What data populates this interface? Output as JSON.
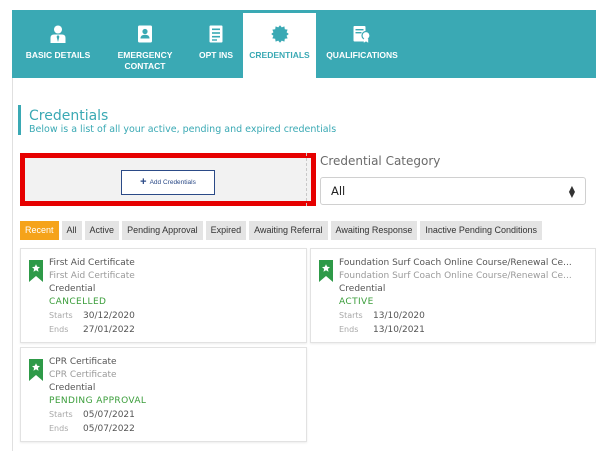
{
  "tabs": [
    {
      "label": "BASIC DETAILS",
      "icon": "person-icon"
    },
    {
      "label": "EMERGENCY CONTACT",
      "icon": "id-card-icon"
    },
    {
      "label": "OPT INS",
      "icon": "checklist-icon"
    },
    {
      "label": "CREDENTIALS",
      "icon": "badge-seal-icon",
      "active": true
    },
    {
      "label": "QUALIFICATIONS",
      "icon": "certificate-icon"
    }
  ],
  "section": {
    "title": "Credentials",
    "subtitle": "Below is a list of all your active, pending and expired credentials"
  },
  "add_button": {
    "label": "Add Credentials",
    "icon": "plus-icon"
  },
  "category": {
    "label": "Credential Category",
    "selected": "All"
  },
  "filters": [
    {
      "label": "Recent",
      "active": true
    },
    {
      "label": "All"
    },
    {
      "label": "Active"
    },
    {
      "label": "Pending Approval"
    },
    {
      "label": "Expired"
    },
    {
      "label": "Awaiting Referral"
    },
    {
      "label": "Awaiting Response"
    },
    {
      "label": "Inactive Pending Conditions"
    }
  ],
  "dates": {
    "starts_label": "Starts",
    "ends_label": "Ends"
  },
  "cards": [
    {
      "title": "First Aid Certificate",
      "subtitle": "First Aid Certificate",
      "type": "Credential",
      "status": "CANCELLED",
      "starts": "30/12/2020",
      "ends": "27/01/2022",
      "status_color": "#3a9d3a"
    },
    {
      "title": "Foundation Surf Coach Online Course/Renewal Ce...",
      "subtitle": "Foundation Surf Coach Online Course/Renewal Ce...",
      "type": "Credential",
      "status": "ACTIVE",
      "starts": "13/10/2020",
      "ends": "13/10/2021",
      "status_color": "#3a9d3a"
    },
    {
      "title": "CPR Certificate",
      "subtitle": "CPR Certificate",
      "type": "Credential",
      "status": "PENDING APPROVAL",
      "starts": "05/07/2021",
      "ends": "05/07/2022",
      "status_color": "#3a9d3a"
    }
  ],
  "colors": {
    "brand": "#3aa9b4",
    "accent": "#f5a31a",
    "badge": "#2e9a48",
    "highlight": "#e60000",
    "button_text": "#2b4a87"
  }
}
